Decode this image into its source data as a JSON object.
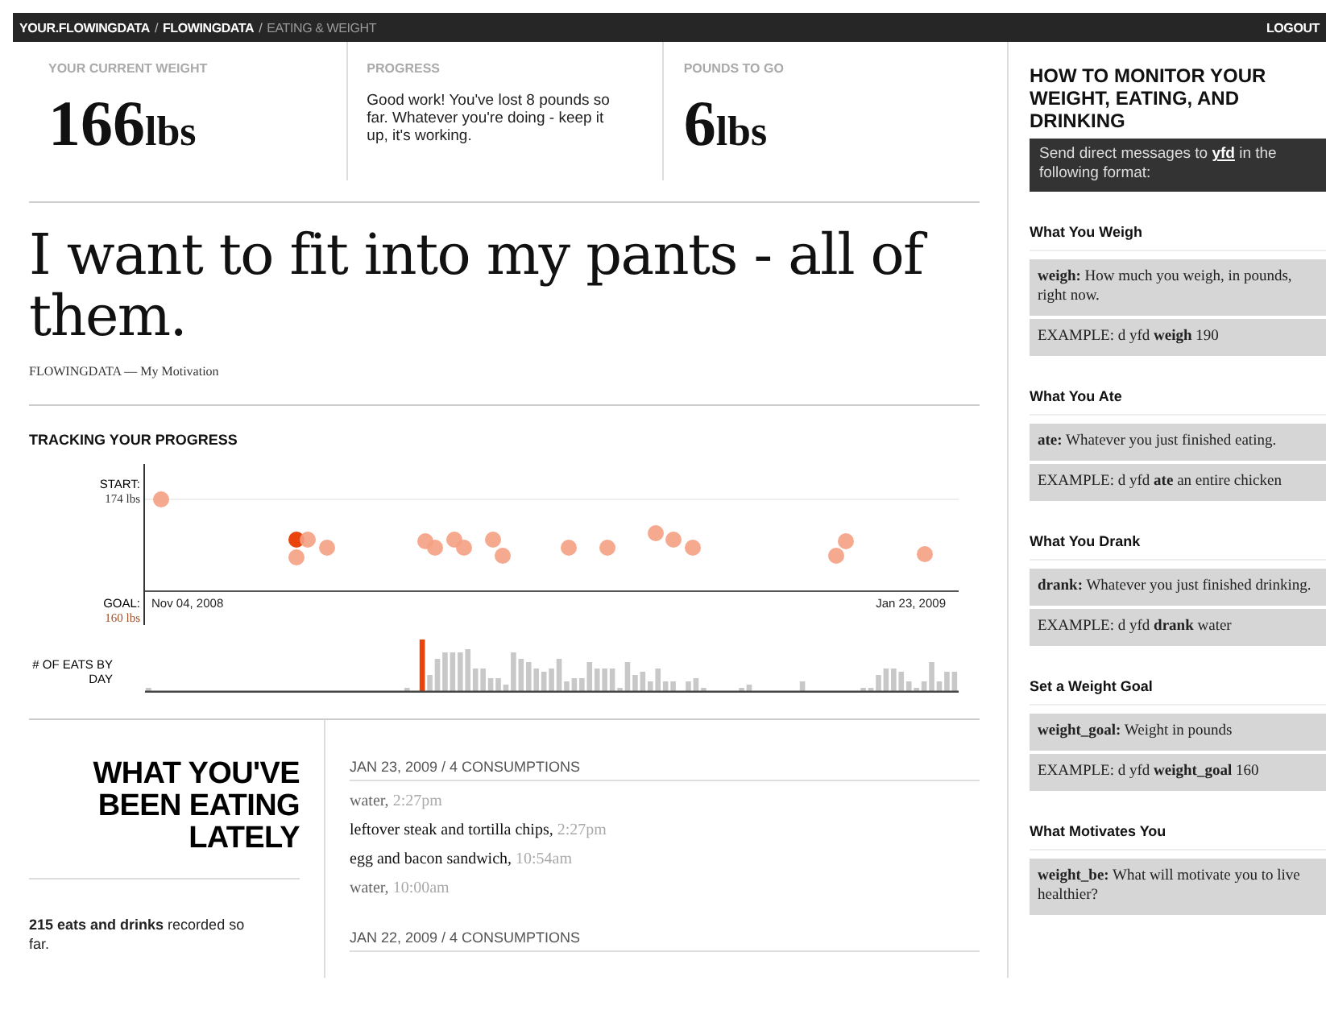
{
  "nav": {
    "crumbs": [
      {
        "label": "YOUR.FLOWINGDATA",
        "selected": false
      },
      {
        "label": "FLOWINGDATA",
        "selected": false
      },
      {
        "label": "EATING & WEIGHT",
        "selected": true
      }
    ],
    "separator": "/",
    "logout": "LOGOUT"
  },
  "stats": [
    {
      "kind": "number",
      "label": "YOUR CURRENT WEIGHT",
      "value": "166",
      "unit": "lbs"
    },
    {
      "kind": "text",
      "label": "PROGRESS",
      "text": "Good work! You've lost 8 pounds so far. Whatever you're doing - keep it up, it's working."
    },
    {
      "kind": "number",
      "label": "POUNDS TO GO",
      "value": "6",
      "unit": "lbs"
    }
  ],
  "motivation": {
    "quote": "I want to fit into my pants - all of them.",
    "source": "FLOWINGDATA — My Motivation"
  },
  "tracking": {
    "title": "TRACKING YOUR PROGRESS",
    "start_label": "START:",
    "start_value": "174 lbs",
    "goal_label": "GOAL:",
    "goal_value": "160 lbs",
    "date_start": "Nov 04, 2008",
    "date_end": "Jan 23, 2009",
    "bars_label": "# OF EATS BY DAY"
  },
  "eating": {
    "title": "WHAT YOU'VE BEEN EATING LATELY",
    "summary": "**215 eats and drinks** recorded so far.",
    "days": [
      {
        "header": "JAN 23, 2009 / 4 CONSUMPTIONS",
        "items": [
          {
            "kind": "drink",
            "name": "water,",
            "time": "2:27pm"
          },
          {
            "kind": "food",
            "name": "leftover steak and tortilla chips,",
            "time": "2:27pm"
          },
          {
            "kind": "food",
            "name": "egg and bacon sandwich,",
            "time": "10:54am"
          },
          {
            "kind": "drink",
            "name": "water,",
            "time": "10:00am"
          }
        ]
      },
      {
        "header": "JAN 22, 2009 / 4 CONSUMPTIONS"
      }
    ]
  },
  "sidebar": {
    "title": "HOW TO MONITOR YOUR WEIGHT, EATING, AND DRINKING",
    "intro_before": "Send direct messages to",
    "intro_link": "yfd",
    "intro_after": "in the following format:",
    "sections": [
      {
        "heading": "What You Weigh",
        "boxes": [
          "**weigh:** How much you weigh, in pounds, right now.",
          "EXAMPLE: d yfd **weigh** 190"
        ]
      },
      {
        "heading": "What You Ate",
        "boxes": [
          "**ate:** Whatever you just finished eating.",
          "EXAMPLE: d yfd **ate** an entire chicken"
        ]
      },
      {
        "heading": "What You Drank",
        "boxes": [
          "**drank:** Whatever you just finished drinking.",
          "EXAMPLE: d yfd **drank** water"
        ]
      },
      {
        "heading": "Set a Weight Goal",
        "boxes": [
          "**weight_goal:** Weight in pounds",
          "EXAMPLE: d yfd **weight_goal** 160"
        ]
      },
      {
        "heading": "What Motivates You",
        "boxes": [
          "**weight_be:** What will motivate you to live healthier?"
        ]
      }
    ]
  }
}
